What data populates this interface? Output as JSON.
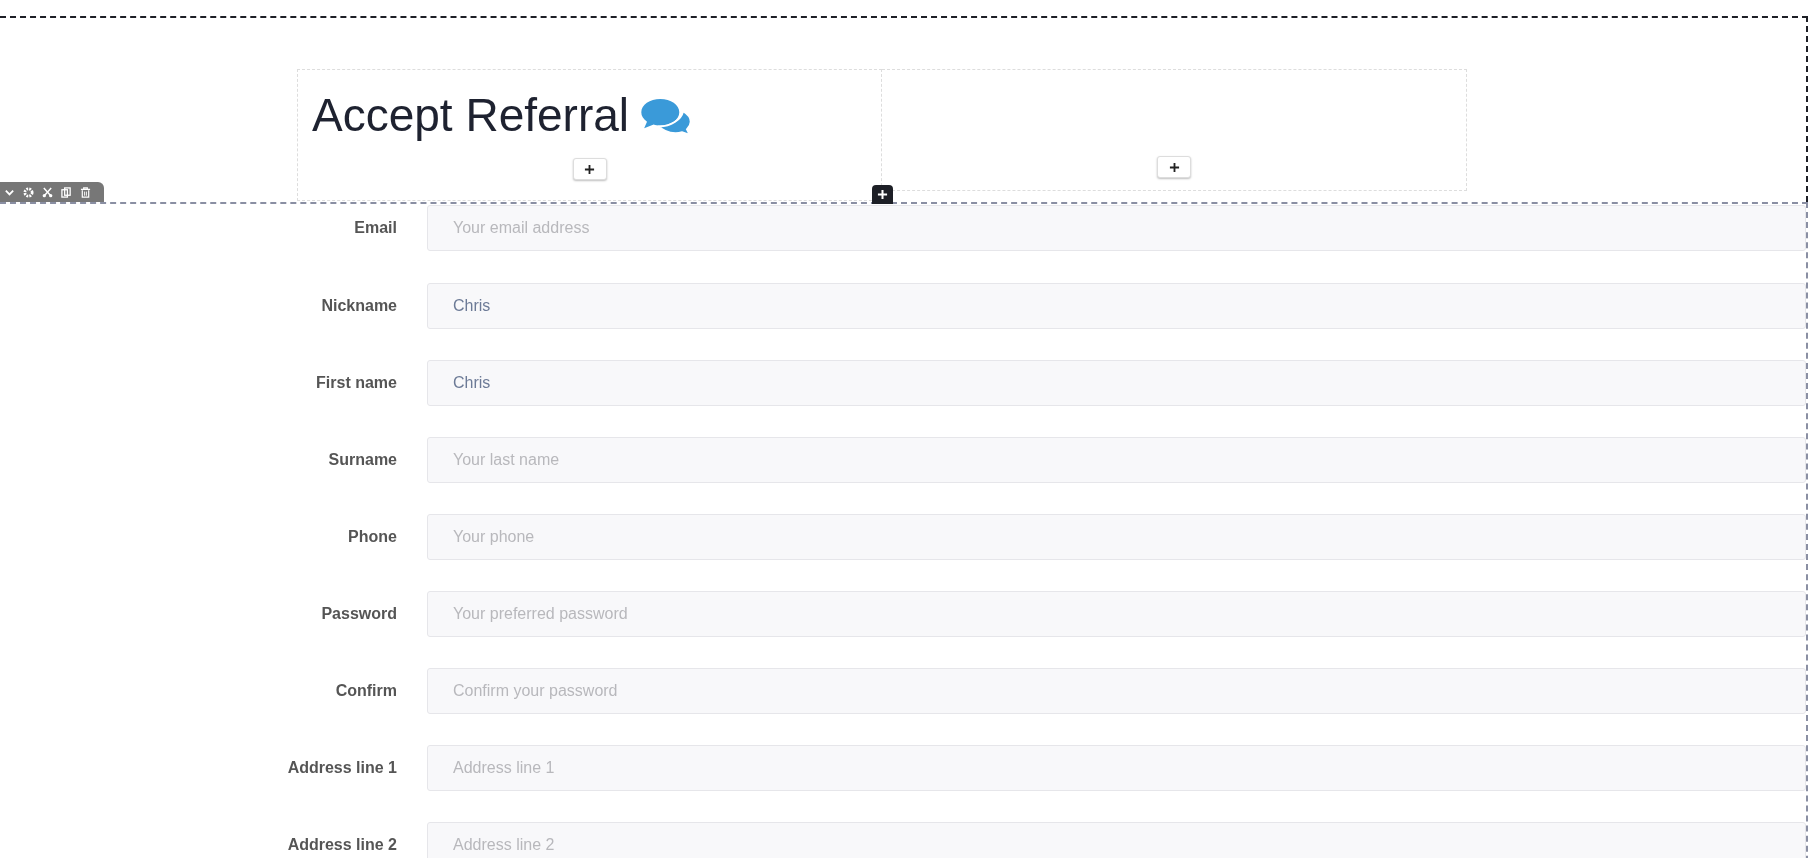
{
  "heading": {
    "title": "Accept Referral"
  },
  "fields": [
    {
      "label": "Email",
      "placeholder": "Your email address"
    },
    {
      "label": "Nickname",
      "value": "Chris"
    },
    {
      "label": "First name",
      "value": "Chris"
    },
    {
      "label": "Surname",
      "placeholder": "Your last name"
    },
    {
      "label": "Phone",
      "placeholder": "Your phone"
    },
    {
      "label": "Password",
      "placeholder": "Your preferred password"
    },
    {
      "label": "Confirm",
      "placeholder": "Confirm your password"
    },
    {
      "label": "Address line 1",
      "placeholder": "Address line 1"
    },
    {
      "label": "Address line 2",
      "placeholder": "Address line 2"
    }
  ]
}
